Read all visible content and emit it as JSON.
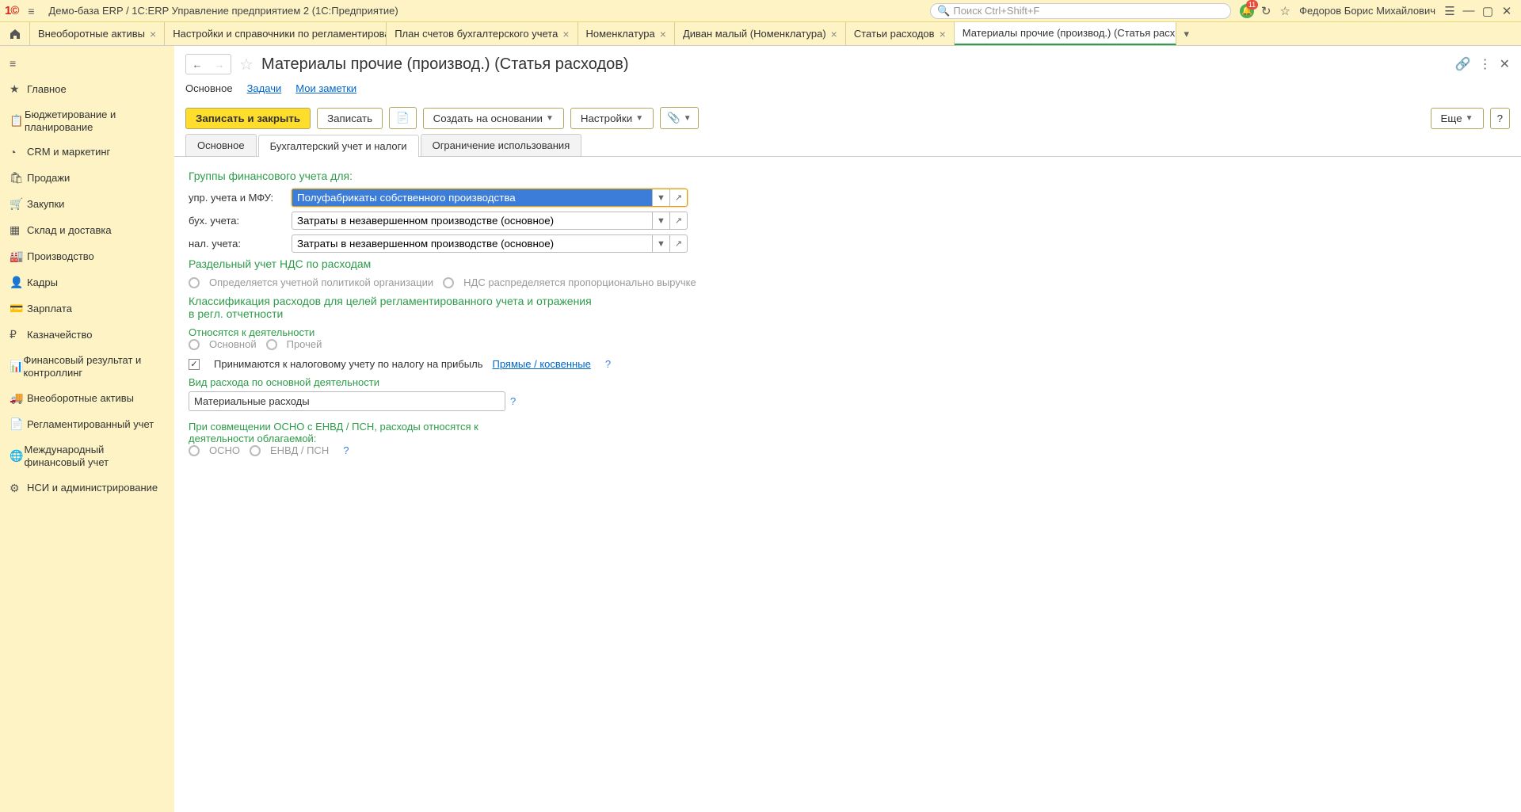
{
  "title_bar": {
    "app_title": "Демо-база ERP / 1С:ERP Управление предприятием 2  (1С:Предприятие)",
    "search_placeholder": "Поиск Ctrl+Shift+F",
    "notification_count": "11",
    "user_name": "Федоров Борис Михайлович"
  },
  "tabs": [
    {
      "label": "Внеоборотные активы"
    },
    {
      "label": "Настройки и справочники по регламентирова..."
    },
    {
      "label": "План счетов бухгалтерского учета"
    },
    {
      "label": "Номенклатура"
    },
    {
      "label": "Диван малый (Номенклатура)"
    },
    {
      "label": "Статьи расходов"
    },
    {
      "label": "Материалы прочие (производ.) (Статья расх..."
    }
  ],
  "sidebar": [
    {
      "label": "Главное"
    },
    {
      "label": "Бюджетирование и планирование"
    },
    {
      "label": "CRM и маркетинг"
    },
    {
      "label": "Продажи"
    },
    {
      "label": "Закупки"
    },
    {
      "label": "Склад и доставка"
    },
    {
      "label": "Производство"
    },
    {
      "label": "Кадры"
    },
    {
      "label": "Зарплата"
    },
    {
      "label": "Казначейство"
    },
    {
      "label": "Финансовый результат и контроллинг"
    },
    {
      "label": "Внеоборотные активы"
    },
    {
      "label": "Регламентированный учет"
    },
    {
      "label": "Международный финансовый учет"
    },
    {
      "label": "НСИ и администрирование"
    }
  ],
  "page": {
    "title": "Материалы прочие (производ.) (Статья расходов)",
    "nav_links": {
      "main": "Основное",
      "tasks": "Задачи",
      "notes": "Мои заметки"
    },
    "toolbar": {
      "save_close": "Записать и закрыть",
      "save": "Записать",
      "create_based": "Создать на основании",
      "settings": "Настройки",
      "more": "Еще",
      "help": "?"
    },
    "subtabs": {
      "main": "Основное",
      "accounting": "Бухгалтерский учет и налоги",
      "restriction": "Ограничение использования"
    },
    "form": {
      "section1_title": "Группы финансового учета для:",
      "label_upr": "упр. учета и МФУ:",
      "value_upr": "Полуфабрикаты собственного производства",
      "label_buh": "бух. учета:",
      "value_buh": "Затраты в незавершенном производстве (основное)",
      "label_nal": "нал. учета:",
      "value_nal": "Затраты в незавершенном производстве (основное)",
      "section2_title": "Раздельный учет НДС по расходам",
      "radio2_a": "Определяется учетной политикой организации",
      "radio2_b": "НДС распределяется пропорционально выручке",
      "section3_title": "Классификация расходов для целей регламентированного учета и отражения в регл. отчетности",
      "activity_label": "Относятся к деятельности",
      "radio3_a": "Основной",
      "radio3_b": "Прочей",
      "checkbox_tax": "Принимаются к налоговому учету по налогу на прибыль",
      "link_direct": "Прямые / косвенные",
      "expense_type_label": "Вид расхода по основной деятельности",
      "expense_type_value": "Материальные расходы",
      "section4_title": "При совмещении ОСНО с ЕНВД / ПСН, расходы относятся к деятельности облагаемой:",
      "radio4_a": "ОСНО",
      "radio4_b": "ЕНВД / ПСН"
    }
  }
}
